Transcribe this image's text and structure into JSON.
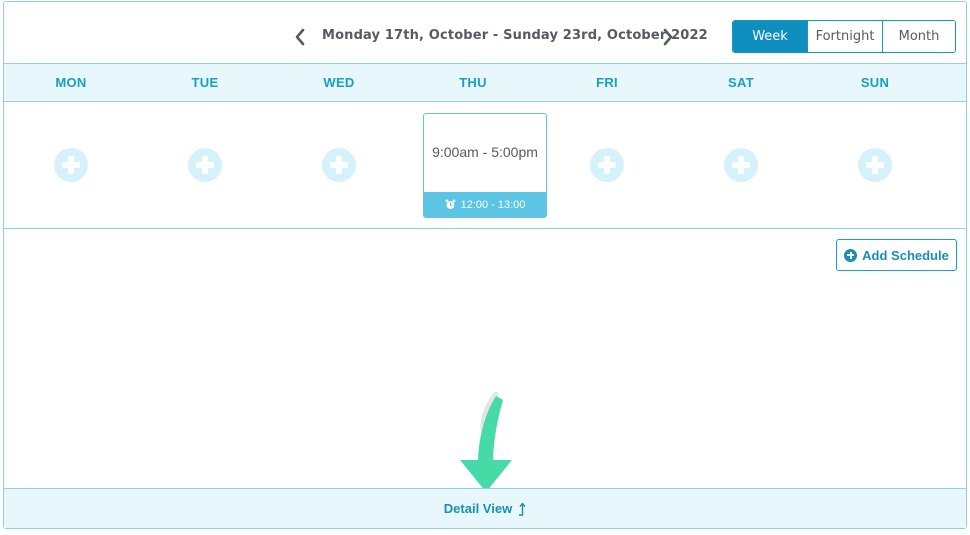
{
  "header": {
    "date_range": "Monday 17th, October - Sunday 23rd, October 2022",
    "view_options": [
      "Week",
      "Fortnight",
      "Month"
    ],
    "active_view": "Week"
  },
  "days": [
    "MON",
    "TUE",
    "WED",
    "THU",
    "FRI",
    "SAT",
    "SUN"
  ],
  "shift": {
    "day": "THU",
    "time": "9:00am - 5:00pm",
    "break": "12:00 - 13:00"
  },
  "actions": {
    "add_schedule": "Add Schedule",
    "detail_view": "Detail View"
  },
  "colors": {
    "accent": "#0e8fbf",
    "light_bg": "#e8f7fb",
    "border": "#8fd3e3",
    "shift_bar": "#5cc4e4",
    "plus_circle": "#d5f1fb",
    "arrow": "#46dba6"
  }
}
